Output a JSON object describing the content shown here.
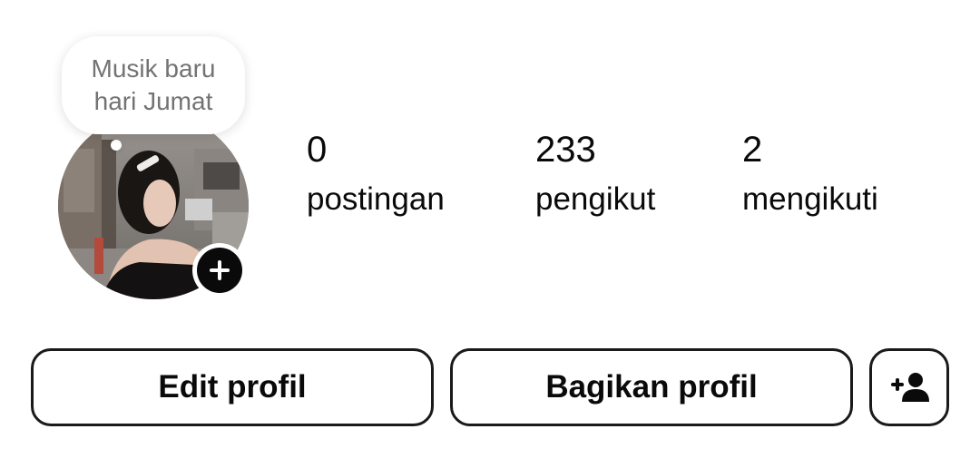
{
  "note": {
    "line1": "Musik baru",
    "line2": "hari Jumat"
  },
  "stats": [
    {
      "value": "0",
      "label": "postingan"
    },
    {
      "value": "233",
      "label": "pengikut"
    },
    {
      "value": "2",
      "label": "mengikuti"
    }
  ],
  "buttons": {
    "edit_label": "Edit profil",
    "share_label": "Bagikan profil"
  },
  "icons": {
    "add_story": "plus-icon",
    "discover_people": "add-person-icon"
  },
  "colors": {
    "text": "#0a0a0a",
    "note_text": "#737373",
    "button_border": "#1a1a1a"
  }
}
